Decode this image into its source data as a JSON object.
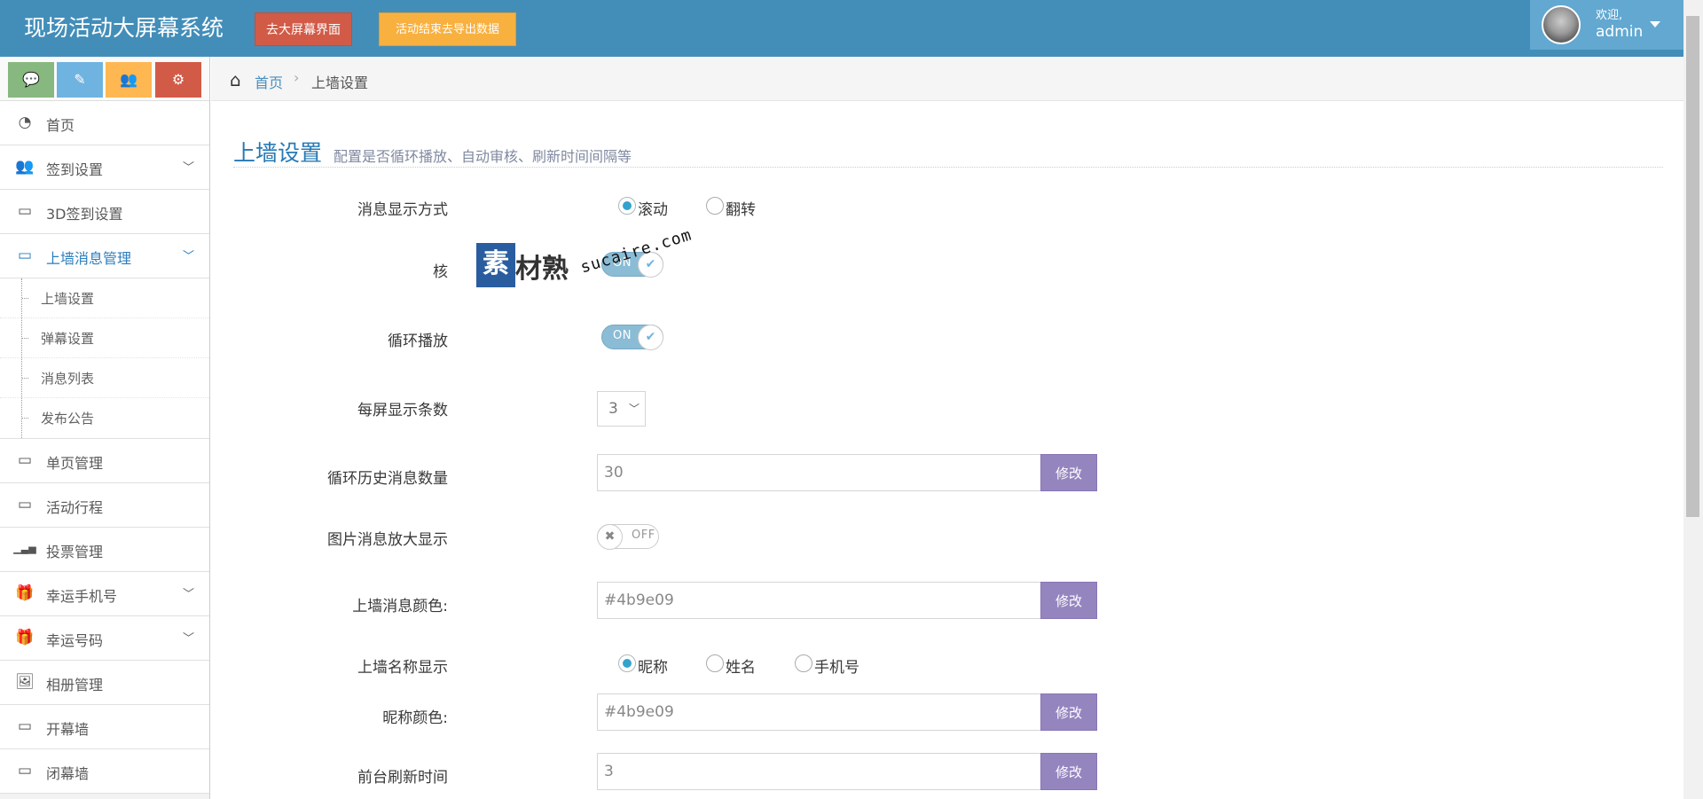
{
  "app": {
    "title": "现场活动大屏幕系统",
    "btn_screen": "去大屏幕界面",
    "btn_export": "活动结束去导出数据"
  },
  "user": {
    "welcome": "欢迎,",
    "name": "admin"
  },
  "sidebar": {
    "shortcuts": [
      {
        "icon": "comments-icon",
        "glyph": "💬",
        "color": "#87b87f"
      },
      {
        "icon": "pencil-icon",
        "glyph": "✎",
        "color": "#6fb3e0"
      },
      {
        "icon": "users-icon",
        "glyph": "👥",
        "color": "#ffb752"
      },
      {
        "icon": "cogs-icon",
        "glyph": "⚙",
        "color": "#d15b47"
      }
    ],
    "items": [
      {
        "label": "首页",
        "icon": "dashboard-icon",
        "glyph": "◔"
      },
      {
        "label": "签到设置",
        "icon": "users-icon",
        "glyph": "👥"
      },
      {
        "label": "3D签到设置",
        "icon": "desktop-icon",
        "glyph": "▭"
      },
      {
        "label": "上墙消息管理",
        "icon": "desktop-icon",
        "glyph": "▭"
      },
      {
        "label": "单页管理",
        "icon": "desktop-icon",
        "glyph": "▭"
      },
      {
        "label": "活动行程",
        "icon": "desktop-icon",
        "glyph": "▭"
      },
      {
        "label": "投票管理",
        "icon": "signal-icon",
        "glyph": "▁▃▅"
      },
      {
        "label": "幸运手机号",
        "icon": "gift-icon",
        "glyph": "🎁"
      },
      {
        "label": "幸运号码",
        "icon": "gift-icon",
        "glyph": "🎁"
      },
      {
        "label": "相册管理",
        "icon": "picture-icon",
        "glyph": "🖼"
      },
      {
        "label": "开幕墙",
        "icon": "desktop-icon",
        "glyph": "▭"
      },
      {
        "label": "闭幕墙",
        "icon": "desktop-icon",
        "glyph": "▭"
      }
    ],
    "submenu": [
      "上墙设置",
      "弹幕设置",
      "消息列表",
      "发布公告"
    ]
  },
  "breadcrumb": {
    "home": "首页",
    "current": "上墙设置"
  },
  "page": {
    "title": "上墙设置",
    "subtitle": "配置是否循环播放、自动审核、刷新时间间隔等"
  },
  "form": {
    "display_mode": {
      "label": "消息显示方式",
      "options": [
        "滚动",
        "翻转"
      ],
      "selected": "滚动"
    },
    "auto_review": {
      "label": "核",
      "state": "ON"
    },
    "loop_play": {
      "label": "循环播放",
      "state": "ON"
    },
    "per_screen": {
      "label": "每屏显示条数",
      "value": "3"
    },
    "history_count": {
      "label": "循环历史消息数量",
      "value": "30",
      "button": "修改"
    },
    "image_zoom": {
      "label": "图片消息放大显示",
      "state": "OFF"
    },
    "msg_color": {
      "label": "上墙消息颜色:",
      "value": "#4b9e09",
      "button": "修改"
    },
    "name_display": {
      "label": "上墙名称显示",
      "options": [
        "昵称",
        "姓名",
        "手机号"
      ],
      "selected": "昵称"
    },
    "nick_color": {
      "label": "昵称颜色:",
      "value": "#4b9e09",
      "button": "修改"
    },
    "refresh_time": {
      "label": "前台刷新时间",
      "value": "3",
      "button": "修改"
    }
  },
  "watermark": {
    "box": "素",
    "text": "材熟",
    "url": "sucaire.com"
  }
}
